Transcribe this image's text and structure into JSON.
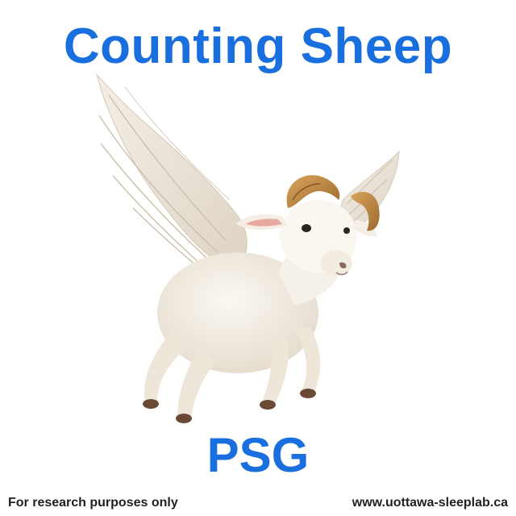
{
  "splash": {
    "title": "Counting Sheep",
    "subtitle": "PSG",
    "mascot": "winged-ram-image",
    "footer": {
      "disclaimer": "For research purposes only",
      "website": "www.uottawa-sleeplab.ca"
    }
  },
  "colors": {
    "brand_blue": "#1a6fdf",
    "background": "#ffffff",
    "footer_text": "#222222"
  }
}
